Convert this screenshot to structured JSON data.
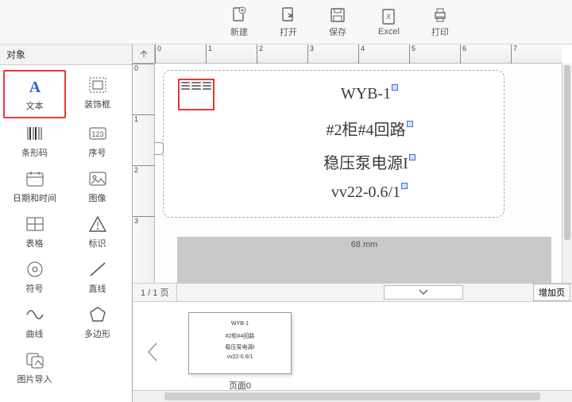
{
  "toolbar": [
    {
      "icon": "new",
      "label": "新建"
    },
    {
      "icon": "open",
      "label": "打开"
    },
    {
      "icon": "save",
      "label": "保存"
    },
    {
      "icon": "excel",
      "label": "Excel"
    },
    {
      "icon": "print",
      "label": "打印"
    }
  ],
  "sidebar": {
    "title": "对象",
    "items": [
      {
        "icon": "text",
        "label": "文本",
        "selected": true
      },
      {
        "icon": "frame",
        "label": "装饰框"
      },
      {
        "icon": "barcode",
        "label": "条形码"
      },
      {
        "icon": "serial",
        "label": "序号"
      },
      {
        "icon": "datetime",
        "label": "日期和时间"
      },
      {
        "icon": "image",
        "label": "图像"
      },
      {
        "icon": "table",
        "label": "表格"
      },
      {
        "icon": "warning",
        "label": "标识"
      },
      {
        "icon": "symbol",
        "label": "符号"
      },
      {
        "icon": "line",
        "label": "直线"
      },
      {
        "icon": "curve",
        "label": "曲线"
      },
      {
        "icon": "polygon",
        "label": "多边形"
      },
      {
        "icon": "imgimport",
        "label": "图片导入"
      }
    ]
  },
  "ruler": {
    "h_ticks": [
      "0",
      "1",
      "2",
      "3",
      "4",
      "5",
      "6",
      "7"
    ],
    "v_ticks": [
      "0",
      "1",
      "2",
      "3"
    ],
    "dimension": "68 mm"
  },
  "label": {
    "lines": [
      "WYB-1",
      "#2柜#4回路",
      "稳压泵电源I",
      "vv22-0.6/1"
    ]
  },
  "pagebar": {
    "info": "1 / 1 页",
    "add_button": "增加页"
  },
  "thumb": {
    "caption": "页面0",
    "lines": [
      "WYB-1",
      "#2柜#4回路",
      "稳压泵电源I",
      "vv22-0.6/1"
    ]
  },
  "colors": {
    "highlight": "#e53935",
    "text_blue": "#2b5fca"
  }
}
